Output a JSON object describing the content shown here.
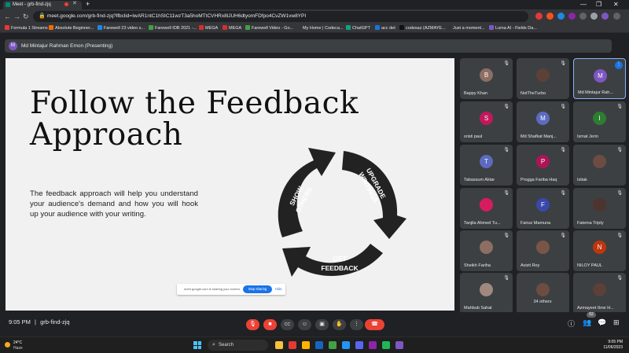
{
  "browser": {
    "tab_title": "Meet - grb-find-zjq",
    "url": "meet.google.com/grb-find-zjq?lfbclid=IwAR1ntC1hSIC11wzT3a5hoMTtCVHRx8lJUH6dtyomFDfpo4CvZW1vw8YPI",
    "new_tab": "+",
    "back": "←",
    "forward": "→",
    "reload": "↻",
    "lock": "🔒",
    "minimize": "—",
    "maximize": "❐",
    "close": "✕"
  },
  "bookmarks": [
    {
      "label": "Formula 1 Streams",
      "color": "#e53935"
    },
    {
      "label": "Absolute Beginner...",
      "color": "#ef6c00"
    },
    {
      "label": "Farewell 23 video s...",
      "color": "#1e88e5"
    },
    {
      "label": "Farewell IDB 2021 -...",
      "color": "#43a047"
    },
    {
      "label": "MEGA",
      "color": "#d32f2f"
    },
    {
      "label": "MEGA",
      "color": "#d32f2f"
    },
    {
      "label": "Farewell Video - Go...",
      "color": "#43a047"
    },
    {
      "label": "My Home | Codeca...",
      "color": "#5c6bc0"
    },
    {
      "label": "ChatGPT",
      "color": "#10a37f"
    },
    {
      "label": "acc det",
      "color": "#1976d2"
    },
    {
      "label": "codesaz (AZMAYE...",
      "color": "#111111"
    },
    {
      "label": "Just a moment...",
      "color": "#333333"
    },
    {
      "label": "Luma AI - Fields Da...",
      "color": "#7e57c2"
    }
  ],
  "presenting": {
    "initial": "M",
    "label": "Md Mintajur Rahman Emon (Presenting)"
  },
  "slide": {
    "title_line1": "Follow the Feedback",
    "title_line2": "Approach",
    "body": "The feedback approach will help you understand your audience's demand and how you will hook up your audience with your writing.",
    "cycle_labels": {
      "show_1": "SHOW",
      "show_2": "OTHERS",
      "upgrade_1": "UPGRADE",
      "upgrade_2": "WRITINGS",
      "get_1": "GET",
      "get_2": "FEEDBACK"
    }
  },
  "sharing_bar": {
    "message": "meet.google.com is sharing your screen.",
    "stop_label": "Stop sharing",
    "hide_label": "Hide"
  },
  "participants": [
    {
      "name": "Bappy Khan",
      "initial": "B",
      "color": "#8d6e63"
    },
    {
      "name": "NotTheTurbo",
      "initial": "",
      "color": "#5d4037"
    },
    {
      "name": "Md Mintajur Rah...",
      "initial": "M",
      "color": "#7e57c2"
    },
    {
      "name": "sristi paul",
      "initial": "S",
      "color": "#c2185b"
    },
    {
      "name": "Md Shafkat Manj...",
      "initial": "M",
      "color": "#5c6bc0"
    },
    {
      "name": "Ismat Jerin",
      "initial": "I",
      "color": "#2e7d32"
    },
    {
      "name": "Tabassum Aktar",
      "initial": "T",
      "color": "#5c6bc0"
    },
    {
      "name": "Progga Fariba Haq",
      "initial": "P",
      "color": "#ad1457"
    },
    {
      "name": "Istiak",
      "initial": "",
      "color": "#6d4c41"
    },
    {
      "name": "Tanjila Ahmed Tu...",
      "initial": "",
      "color": "#d81b60"
    },
    {
      "name": "Fairuz Mamuna",
      "initial": "F",
      "color": "#3949ab"
    },
    {
      "name": "Fatema Tripty",
      "initial": "",
      "color": "#4e342e"
    },
    {
      "name": "Sheikh Fariha",
      "initial": "",
      "color": "#8d6e63"
    },
    {
      "name": "Avizit Roy",
      "initial": "",
      "color": "#795548"
    },
    {
      "name": "NILOY PAUL",
      "initial": "N",
      "color": "#bf360c"
    },
    {
      "name": "Mahbub Sahal",
      "initial": "",
      "color": "#a1887f"
    },
    {
      "name": "34 others",
      "initial": "",
      "color": "#6d4c41"
    },
    {
      "name": "Azmayeet Ibne H...",
      "initial": "",
      "color": "#5d4037"
    }
  ],
  "meeting": {
    "time": "9:05 PM",
    "separator": "|",
    "code": "grb-find-zjq",
    "people_count": "62",
    "mic_icon": "🎙",
    "cam_icon": "■",
    "cc_icon": "CC",
    "emoji_icon": "☺",
    "present_icon": "▣",
    "hand_icon": "✋",
    "more_icon": "⋮",
    "end_icon": "☎",
    "info_icon": "ⓘ",
    "people_icon": "👥",
    "chat_icon": "💬",
    "activities_icon": "⊞"
  },
  "taskbar": {
    "temp": "24°C",
    "condition": "Haze",
    "search_label": "Search",
    "time": "9:05 PM",
    "date": "11/06/2023",
    "apps": [
      "#f6c23e",
      "#e53935",
      "#ffb300",
      "#1565c0",
      "#43a047",
      "#2196f3",
      "#5865f2",
      "#8e24aa",
      "#1db954",
      "#7e57c2"
    ]
  },
  "colors": {
    "accent": "#1a73e8",
    "danger": "#ea4335",
    "tile": "#3c4043"
  }
}
